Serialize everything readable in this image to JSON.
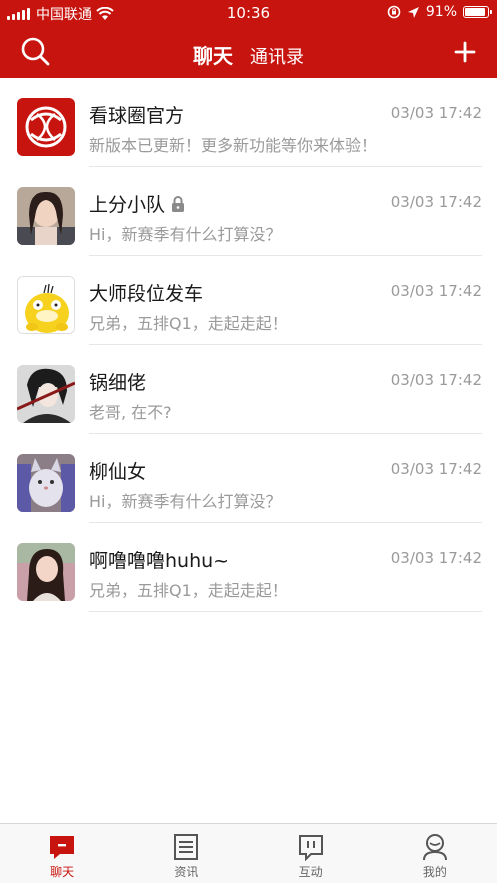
{
  "status_bar": {
    "carrier": "中国联通",
    "time": "10:36",
    "battery": "91%",
    "battery_level": 0.91
  },
  "nav": {
    "tab_active": "聊天",
    "tab_inactive": "通讯录",
    "search_icon": "search-icon",
    "add_icon": "plus-icon"
  },
  "chats": [
    {
      "name": "看球圈官方",
      "time": "03/03 17:42",
      "preview": "新版本已更新！更多新功能等你来体验！",
      "locked": false
    },
    {
      "name": "上分小队",
      "time": "03/03 17:42",
      "preview": "Hi，新赛季有什么打算没？",
      "locked": true
    },
    {
      "name": "大师段位发车",
      "time": "03/03 17:42",
      "preview": "兄弟，五排Q1，走起走起！",
      "locked": false
    },
    {
      "name": "锅细佬",
      "time": "03/03 17:42",
      "preview": "老哥, 在不?",
      "locked": false
    },
    {
      "name": "柳仙女",
      "time": "03/03 17:42",
      "preview": "Hi，新赛季有什么打算没？",
      "locked": false
    },
    {
      "name": "啊噜噜噜huhu~",
      "time": "03/03 17:42",
      "preview": "兄弟，五排Q1，走起走起！",
      "locked": false
    }
  ],
  "tab_bar": [
    {
      "label": "聊天",
      "icon": "chat-icon",
      "active": true
    },
    {
      "label": "资讯",
      "icon": "news-icon",
      "active": false
    },
    {
      "label": "互动",
      "icon": "interact-icon",
      "active": false
    },
    {
      "label": "我的",
      "icon": "profile-icon",
      "active": false
    }
  ],
  "colors": {
    "brand_red": "#c8140f",
    "text_primary": "#1a1a1a",
    "text_secondary": "#9a9a9a"
  }
}
